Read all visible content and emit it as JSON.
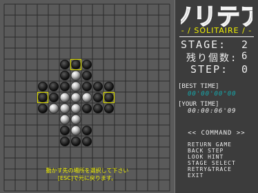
{
  "board": {
    "grid_color": "#2a2a2a",
    "background": "#5a5a5a",
    "highlight_color": "#d8d800",
    "pegs": [
      {
        "col": 6,
        "row": 6
      },
      {
        "col": 6,
        "row": 7
      },
      {
        "col": 5,
        "row": 8
      },
      {
        "col": 6,
        "row": 8
      },
      {
        "col": 7,
        "row": 8
      },
      {
        "col": 4,
        "row": 9
      },
      {
        "col": 5,
        "row": 9
      },
      {
        "col": 6,
        "row": 9
      },
      {
        "col": 5,
        "row": 10
      },
      {
        "col": 6,
        "row": 10
      },
      {
        "col": 6,
        "row": 11
      }
    ],
    "holes": [
      {
        "col": 5,
        "row": 5
      },
      {
        "col": 6,
        "row": 5
      },
      {
        "col": 7,
        "row": 5
      },
      {
        "col": 5,
        "row": 6
      },
      {
        "col": 7,
        "row": 6
      },
      {
        "col": 3,
        "row": 7
      },
      {
        "col": 4,
        "row": 7
      },
      {
        "col": 5,
        "row": 7
      },
      {
        "col": 7,
        "row": 7
      },
      {
        "col": 8,
        "row": 7
      },
      {
        "col": 9,
        "row": 7
      },
      {
        "col": 3,
        "row": 8
      },
      {
        "col": 4,
        "row": 8
      },
      {
        "col": 8,
        "row": 8
      },
      {
        "col": 9,
        "row": 8
      },
      {
        "col": 3,
        "row": 9
      },
      {
        "col": 7,
        "row": 9
      },
      {
        "col": 8,
        "row": 9
      },
      {
        "col": 9,
        "row": 9
      },
      {
        "col": 5,
        "row": 11
      },
      {
        "col": 7,
        "row": 11
      },
      {
        "col": 5,
        "row": 12
      },
      {
        "col": 6,
        "row": 12
      },
      {
        "col": 7,
        "row": 12
      }
    ],
    "highlights": [
      {
        "col": 6,
        "row": 5
      },
      {
        "col": 3,
        "row": 8
      },
      {
        "col": 9,
        "row": 8
      }
    ]
  },
  "message": {
    "line1": "動かす先の場所を選択して下さい",
    "line2": "[ESC]で元に戻ります。"
  },
  "panel": {
    "logo_title": "ソリテア",
    "logo_subtitle": "- / SOLITAIRE / -",
    "stage_label": "STAGE:",
    "stage_value": "2",
    "remaining_label": "残り個数:",
    "remaining_value": "6",
    "step_label": "STEP:",
    "step_value": "0",
    "best_time_label": "[BEST TIME]",
    "best_time_value": "00'00'00\"00",
    "your_time_label": "[YOUR TIME]",
    "your_time_value": "00:00:06'09",
    "command_title": "<< COMMAND >>",
    "commands": [
      "RETURN GAME",
      "BACK STEP",
      "LOOK HINT",
      "STAGE SELECT",
      "RETRY&TRACE",
      "EXIT"
    ],
    "best_time_color": "#16a9ad",
    "your_time_color": "#f0f0f0"
  }
}
